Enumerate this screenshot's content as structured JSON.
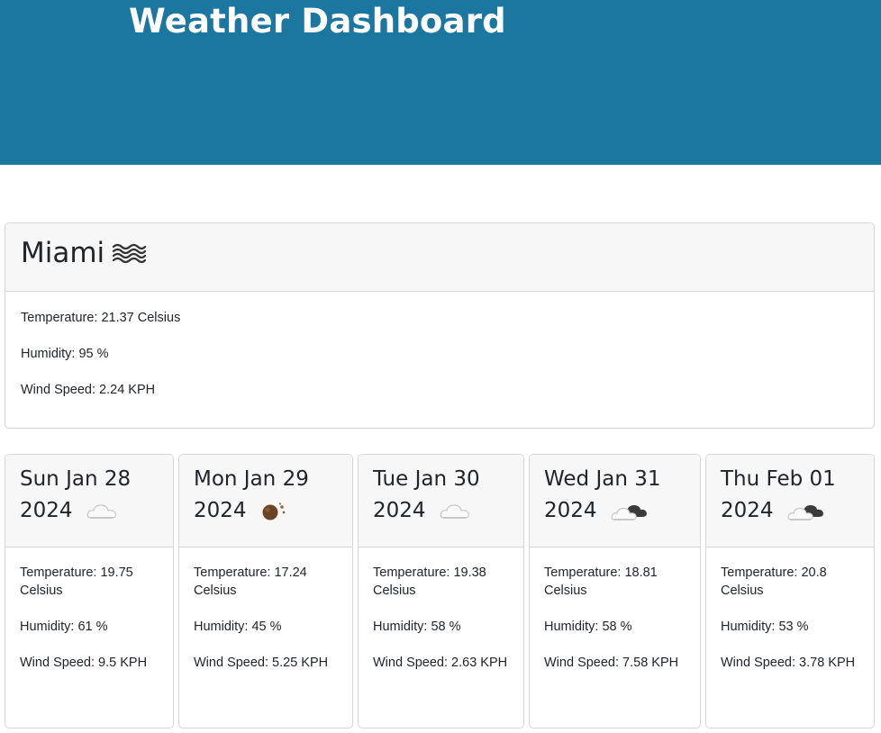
{
  "header": {
    "title": "Weather Dashboard"
  },
  "current": {
    "city": "Miami",
    "icon": "mist-icon",
    "temperature": "Temperature: 21.37 Celsius",
    "humidity": "Humidity: 95 %",
    "wind": "Wind Speed: 2.24 KPH"
  },
  "forecast": [
    {
      "date": "Sun Jan 28 2024",
      "icon": "cloud-icon",
      "temperature": "Temperature: 19.75 Celsius",
      "humidity": "Humidity: 61 %",
      "wind": "Wind Speed: 9.5 KPH"
    },
    {
      "date": "Mon Jan 29 2024",
      "icon": "clear-sky-icon",
      "temperature": "Temperature: 17.24 Celsius",
      "humidity": "Humidity: 45 %",
      "wind": "Wind Speed: 5.25 KPH"
    },
    {
      "date": "Tue Jan 30 2024",
      "icon": "cloud-icon",
      "temperature": "Temperature: 19.38 Celsius",
      "humidity": "Humidity: 58 %",
      "wind": "Wind Speed: 2.63 KPH"
    },
    {
      "date": "Wed Jan 31 2024",
      "icon": "broken-clouds-icon",
      "temperature": "Temperature: 18.81 Celsius",
      "humidity": "Humidity: 58 %",
      "wind": "Wind Speed: 7.58 KPH"
    },
    {
      "date": "Thu Feb 01 2024",
      "icon": "broken-clouds-icon",
      "temperature": "Temperature: 20.8 Celsius",
      "humidity": "Humidity: 53 %",
      "wind": "Wind Speed: 3.78 KPH"
    }
  ]
}
